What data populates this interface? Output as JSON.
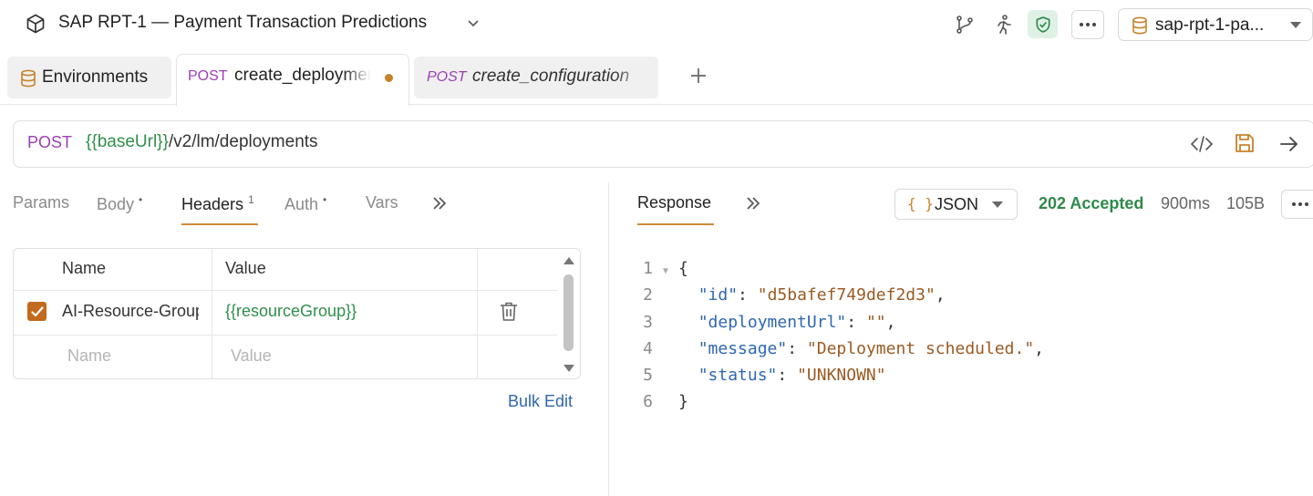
{
  "app": {
    "title": "SAP RPT-1 — Payment Transaction Predictions",
    "environment_select": "sap-rpt-1-pa..."
  },
  "tabs": {
    "environments": "Environments",
    "items": [
      {
        "method": "POST",
        "name": "create_deployment",
        "unsaved": true
      },
      {
        "method": "POST",
        "name": "create_configuration"
      }
    ]
  },
  "request": {
    "method": "POST",
    "url_var": "{{baseUrl}}",
    "url_path": "/v2/lm/deployments"
  },
  "request_tabs": {
    "params": "Params",
    "body": "Body",
    "body_dot": "•",
    "headers": "Headers",
    "headers_count": "1",
    "auth": "Auth",
    "auth_dot": "•",
    "vars": "Vars",
    "active": "Headers"
  },
  "headers_table": {
    "col_name": "Name",
    "col_value": "Value",
    "rows": [
      {
        "enabled": true,
        "name": "AI-Resource-Group",
        "value": "{{resourceGroup}}"
      }
    ],
    "placeholder_name": "Name",
    "placeholder_value": "Value",
    "bulk_edit": "Bulk Edit"
  },
  "response": {
    "tab_label": "Response",
    "format_icon": "{ }",
    "format": "JSON",
    "status": "202 Accepted",
    "time": "900ms",
    "size": "105B",
    "lines": [
      "1",
      "2",
      "3",
      "4",
      "5",
      "6"
    ],
    "json": {
      "open": "{",
      "k_id": "\"id\"",
      "v_id": "\"d5bafef749def2d3\"",
      "k_url": "\"deploymentUrl\"",
      "v_url": "\"\"",
      "k_msg": "\"message\"",
      "v_msg": "\"Deployment scheduled.\"",
      "k_status": "\"status\"",
      "v_status": "\"UNKNOWN\"",
      "close": "}"
    }
  },
  "colors": {
    "method_post": "#9b3fb5",
    "variable": "#2f8f4a",
    "accent": "#d18a3b",
    "status_ok": "#2e8a4c",
    "json_key": "#2f67b2",
    "json_string": "#9a5a23"
  },
  "icons": [
    "cube-icon",
    "chevron-down-icon",
    "git-branch-icon",
    "run-icon",
    "shield-check-icon",
    "more-icon",
    "database-icon",
    "plus-icon",
    "code-icon",
    "save-icon",
    "arrow-right-icon",
    "double-chevron-right-icon",
    "trash-icon",
    "check-icon"
  ]
}
